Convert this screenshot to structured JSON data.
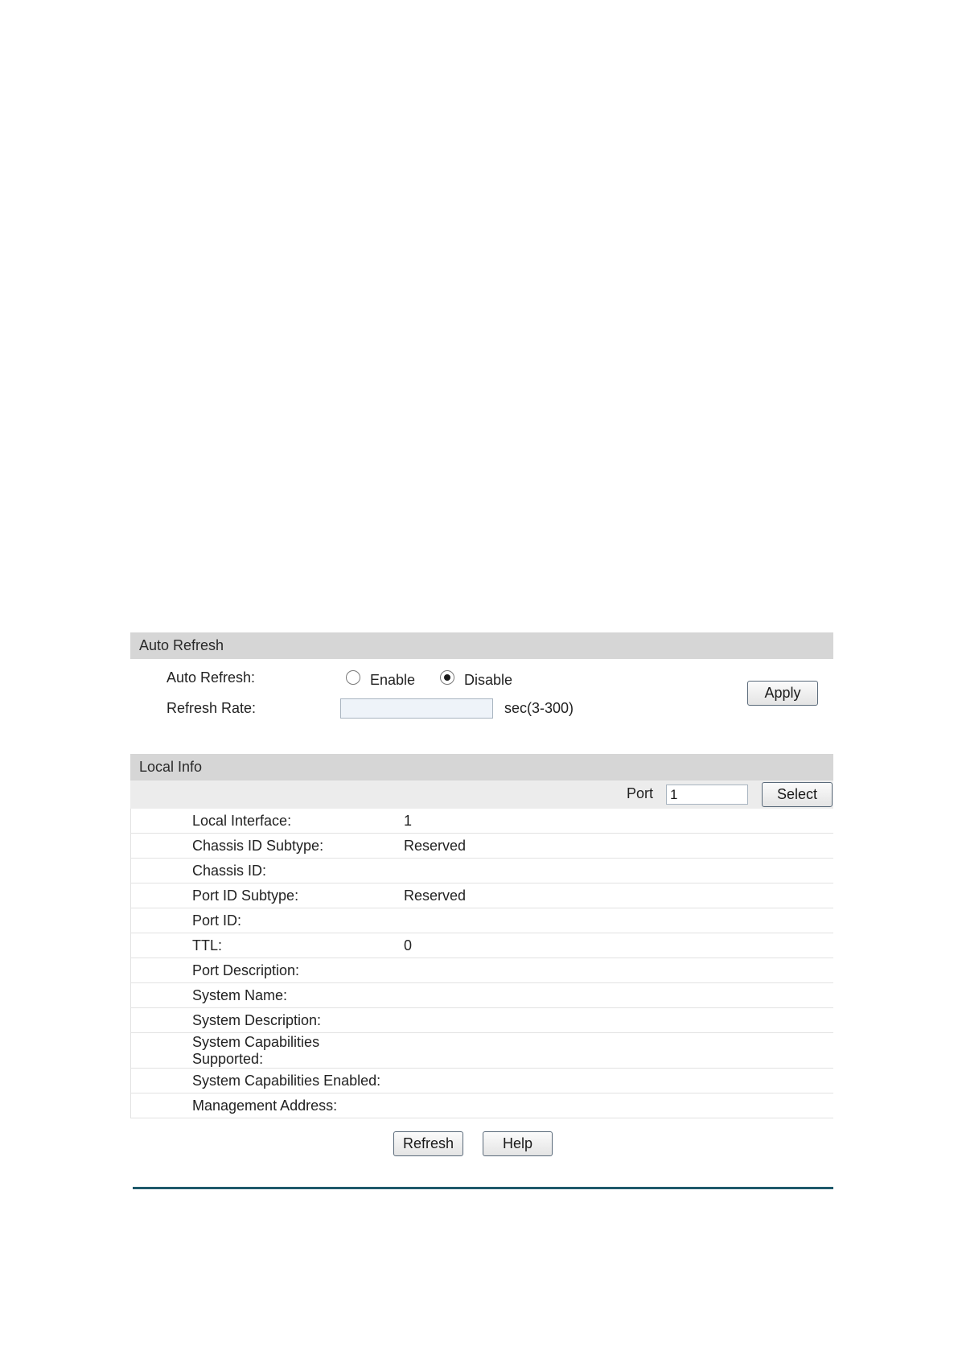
{
  "auto_refresh": {
    "section_title": "Auto Refresh",
    "auto_refresh_label": "Auto Refresh:",
    "enable_label": "Enable",
    "disable_label": "Disable",
    "selected": "Disable",
    "refresh_rate_label": "Refresh Rate:",
    "refresh_rate_value": "",
    "refresh_rate_unit": "sec(3-300)",
    "apply_label": "Apply"
  },
  "local_info": {
    "section_title": "Local Info",
    "port_label": "Port",
    "port_value": "1",
    "select_label": "Select",
    "rows": [
      {
        "label": "Local Interface:",
        "value": "1"
      },
      {
        "label": "Chassis ID Subtype:",
        "value": "Reserved"
      },
      {
        "label": "Chassis ID:",
        "value": ""
      },
      {
        "label": "Port ID Subtype:",
        "value": "Reserved"
      },
      {
        "label": "Port ID:",
        "value": ""
      },
      {
        "label": "TTL:",
        "value": "0"
      },
      {
        "label": "Port Description:",
        "value": ""
      },
      {
        "label": "System Name:",
        "value": ""
      },
      {
        "label": "System Description:",
        "value": ""
      },
      {
        "label": "System Capabilities Supported:",
        "value": ""
      },
      {
        "label": "System Capabilities Enabled:",
        "value": ""
      },
      {
        "label": "Management Address:",
        "value": ""
      }
    ]
  },
  "footer": {
    "refresh_label": "Refresh",
    "help_label": "Help"
  }
}
